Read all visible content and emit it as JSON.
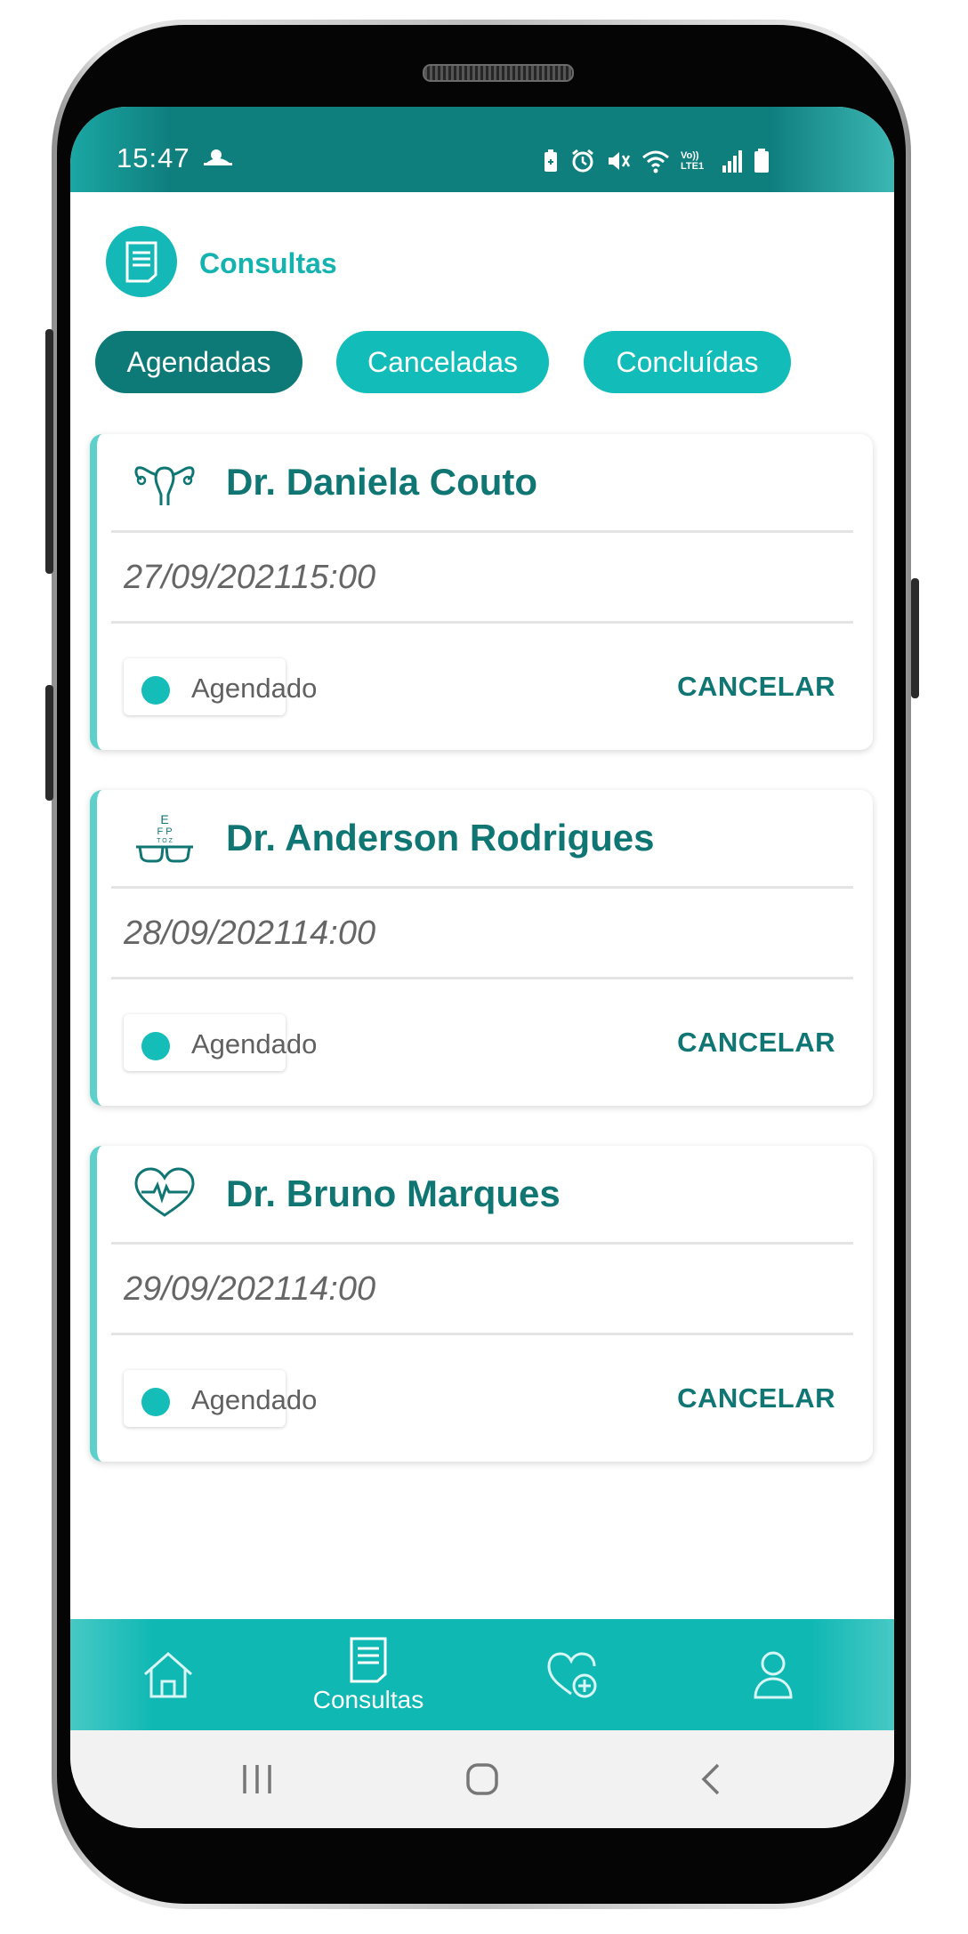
{
  "status_bar": {
    "time": "15:47",
    "icons": [
      "weather-icon",
      "battery-saver-icon",
      "alarm-icon",
      "mute-icon",
      "wifi-icon",
      "volte-icon",
      "signal-icon",
      "battery-icon"
    ],
    "volte_text": "Vo)) LTE1"
  },
  "header": {
    "title": "Consultas",
    "icon": "document-icon"
  },
  "tabs": [
    {
      "label": "Agendadas",
      "active": true
    },
    {
      "label": "Canceladas",
      "active": false
    },
    {
      "label": "Concluídas",
      "active": false
    }
  ],
  "appointments": [
    {
      "doctor": "Dr. Daniela Couto",
      "specialty_icon": "uterus-icon",
      "date": "27/09/2021",
      "time": "15:00",
      "status": "Agendado",
      "action": "CANCELAR"
    },
    {
      "doctor": "Dr. Anderson Rodrigues",
      "specialty_icon": "eye-chart-glasses-icon",
      "date": "28/09/2021",
      "time": "14:00",
      "status": "Agendado",
      "action": "CANCELAR"
    },
    {
      "doctor": "Dr. Bruno Marques",
      "specialty_icon": "heart-pulse-icon",
      "date": "29/09/2021",
      "time": "14:00",
      "status": "Agendado",
      "action": "CANCELAR"
    }
  ],
  "bottom_nav": [
    {
      "icon": "home-icon",
      "label": ""
    },
    {
      "icon": "document-icon",
      "label": "Consultas"
    },
    {
      "icon": "heart-plus-icon",
      "label": ""
    },
    {
      "icon": "user-icon",
      "label": ""
    }
  ],
  "system_nav": [
    "recents-icon",
    "home-button-icon",
    "back-icon"
  ],
  "colors": {
    "primary": "#0f7f7e",
    "accent": "#12bdb9",
    "tab_active": "#0d7a78",
    "doctor_text": "#0f7674",
    "card_border": "#5ed0cc"
  },
  "eye_chart_letters": {
    "row1": "E",
    "row2": "F P",
    "row3": "T O Z"
  }
}
